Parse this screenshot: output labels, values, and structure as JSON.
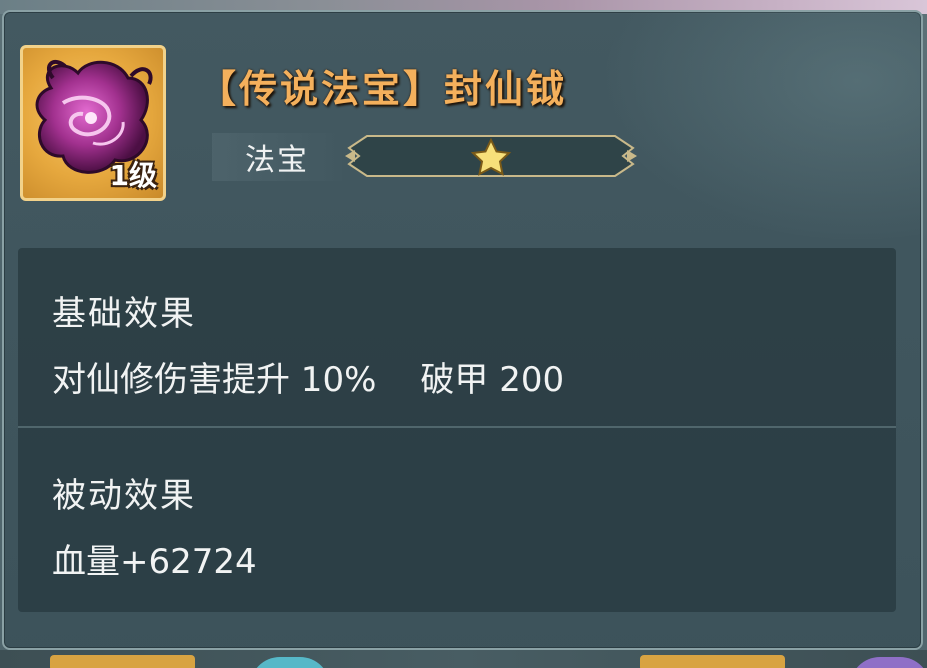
{
  "item": {
    "title": "【传说法宝】封仙钺",
    "level": "1级",
    "category": "法宝",
    "stars": 1
  },
  "effects": {
    "base": {
      "header": "基础效果",
      "stat1": "对仙修伤害提升 10%",
      "stat2": "破甲 200"
    },
    "passive": {
      "header": "被动效果",
      "stat1": "血量+62724"
    }
  },
  "colors": {
    "title": "#f4b05c",
    "panel": "#42585f",
    "icon_border": "#f2d28a",
    "star": "#f7e07a"
  },
  "icons": {
    "item": "purple-orb-treasure-icon",
    "star": "star-icon"
  }
}
